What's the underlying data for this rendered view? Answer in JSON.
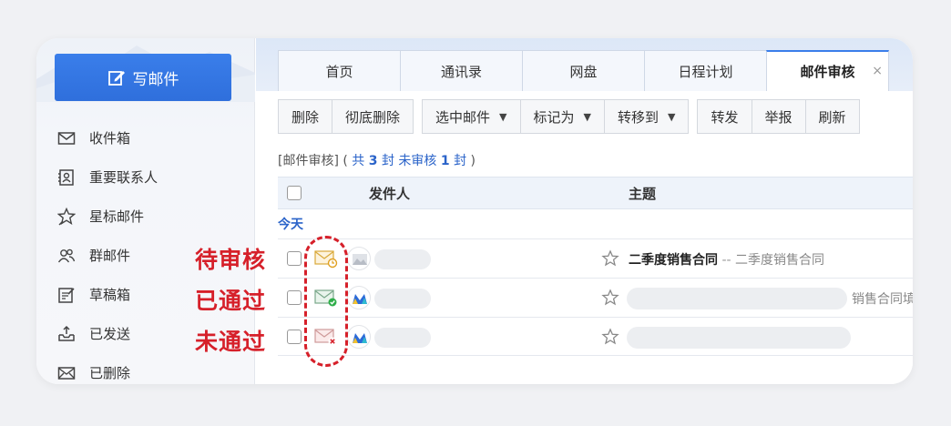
{
  "sidebar": {
    "compose_label": "写邮件",
    "items": [
      {
        "label": "收件箱",
        "icon": "inbox-icon"
      },
      {
        "label": "重要联系人",
        "icon": "contact-card-icon"
      },
      {
        "label": "星标邮件",
        "icon": "star-icon"
      },
      {
        "label": "群邮件",
        "icon": "group-icon"
      },
      {
        "label": "草稿箱",
        "icon": "draft-icon"
      },
      {
        "label": "已发送",
        "icon": "sent-icon"
      },
      {
        "label": "已删除",
        "icon": "deleted-icon"
      }
    ]
  },
  "tabs": [
    {
      "label": "首页"
    },
    {
      "label": "通讯录"
    },
    {
      "label": "网盘"
    },
    {
      "label": "日程计划"
    },
    {
      "label": "邮件审核",
      "active": true,
      "close": "×"
    }
  ],
  "toolbar": {
    "delete": "删除",
    "delete_permanently": "彻底删除",
    "select_mail": "选中邮件",
    "mark_as": "标记为",
    "move_to": "转移到",
    "forward": "转发",
    "report": "举报",
    "refresh": "刷新",
    "caret": "▼"
  },
  "summary": {
    "prefix": "[邮件审核] ( ",
    "total_label": "共",
    "total": "3",
    "unit1": "封",
    "pending_label": "未审核",
    "pending": "1",
    "unit2": "封",
    "suffix": " )"
  },
  "table": {
    "col_sender": "发件人",
    "col_subject": "主题",
    "group": "今天",
    "rows": [
      {
        "subject": "二季度销售合同",
        "separator": " -- ",
        "preview": "二季度销售合同",
        "status": "pending"
      },
      {
        "tail": "销售合同填",
        "status": "approved"
      },
      {
        "status": "rejected"
      }
    ]
  },
  "annotations": {
    "pending": "待审核",
    "approved": "已通过",
    "rejected": "未通过"
  },
  "colors": {
    "accent": "#3a7eea",
    "annotation": "#d6202a",
    "link": "#2a63c9"
  }
}
